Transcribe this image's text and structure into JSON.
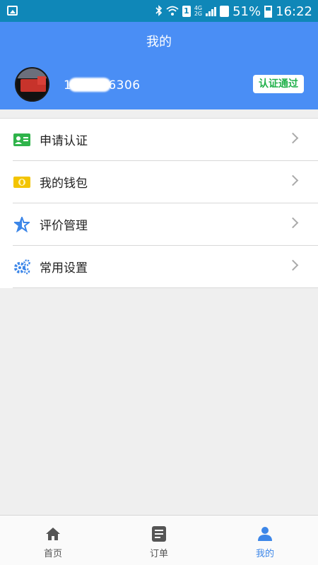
{
  "status_bar": {
    "battery": "51%",
    "time": "16:22",
    "sim": "1",
    "network_top": "4G",
    "network_bottom": "2G",
    "icons": [
      "image-icon",
      "bluetooth-icon",
      "wifi-icon",
      "sim-icon",
      "signal-icon",
      "sim2-icon",
      "battery-icon"
    ]
  },
  "header": {
    "title": "我的",
    "phone_prefix": "1",
    "phone_suffix": "6306",
    "badge": "认证通过",
    "colors": {
      "background": "#4a8ef5",
      "badge_text": "#22b14c"
    }
  },
  "menu": {
    "items": [
      {
        "label": "申请认证",
        "icon": "id-card-icon",
        "color": "#2fb34a"
      },
      {
        "label": "我的钱包",
        "icon": "wallet-icon",
        "color": "#f3c400"
      },
      {
        "label": "评价管理",
        "icon": "star-icon",
        "color": "#3c86e8"
      },
      {
        "label": "常用设置",
        "icon": "settings-gears-icon",
        "color": "#3c86e8"
      }
    ]
  },
  "bottom_nav": {
    "tabs": [
      {
        "label": "首页",
        "icon": "home-icon",
        "active": false
      },
      {
        "label": "订单",
        "icon": "orders-icon",
        "active": false
      },
      {
        "label": "我的",
        "icon": "user-icon",
        "active": true
      }
    ],
    "colors": {
      "active": "#3c86e8",
      "inactive": "#555555"
    }
  }
}
